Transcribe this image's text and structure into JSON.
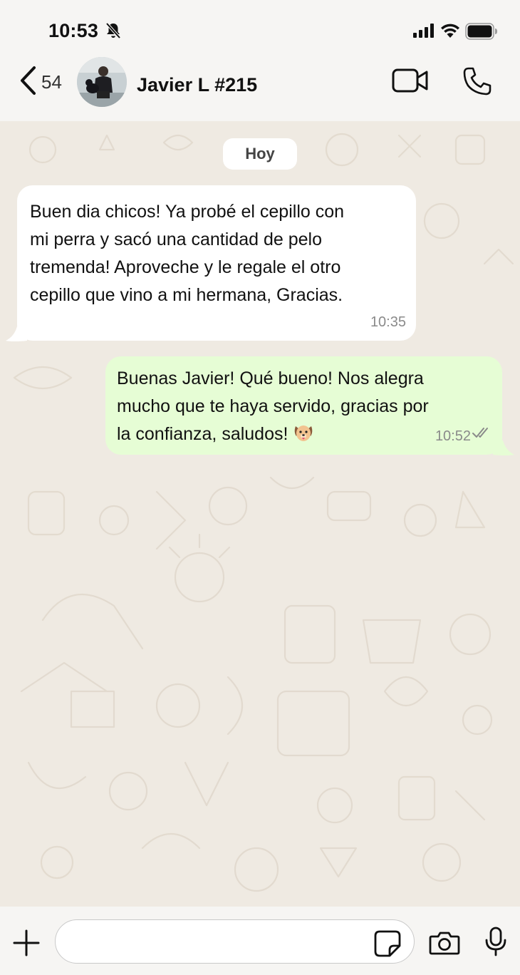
{
  "status_bar": {
    "time": "10:53",
    "icons": [
      "bell-off-icon",
      "signal-icon",
      "wifi-icon",
      "battery-icon"
    ]
  },
  "header": {
    "back_count": "54",
    "contact_name": "Javier L #215",
    "icons": [
      "back-chevron-icon",
      "video-call-icon",
      "phone-icon"
    ]
  },
  "chat": {
    "date_label": "Hoy",
    "messages": [
      {
        "direction": "incoming",
        "lines": [
          "Buen dia chicos! Ya probé el cepillo con",
          "mi perra y sacó una cantidad de pelo",
          "tremenda! Aproveche y le regale el otro",
          "cepillo que vino a mi hermana, Gracias."
        ],
        "time": "10:35"
      },
      {
        "direction": "outgoing",
        "lines": [
          "Buenas Javier! Qué bueno! Nos alegra",
          "mucho que te haya servido, gracias por",
          "la confianza, saludos!"
        ],
        "emoji": "dog-face",
        "time": "10:52",
        "status": "read"
      }
    ]
  },
  "input_bar": {
    "placeholder": "",
    "icons": [
      "plus-icon",
      "sticker-icon",
      "camera-icon",
      "microphone-icon"
    ]
  },
  "colors": {
    "chat_background": "#efeae2",
    "incoming_bubble": "#ffffff",
    "outgoing_bubble": "#e6fdd5",
    "bar_background": "#f6f5f3"
  }
}
